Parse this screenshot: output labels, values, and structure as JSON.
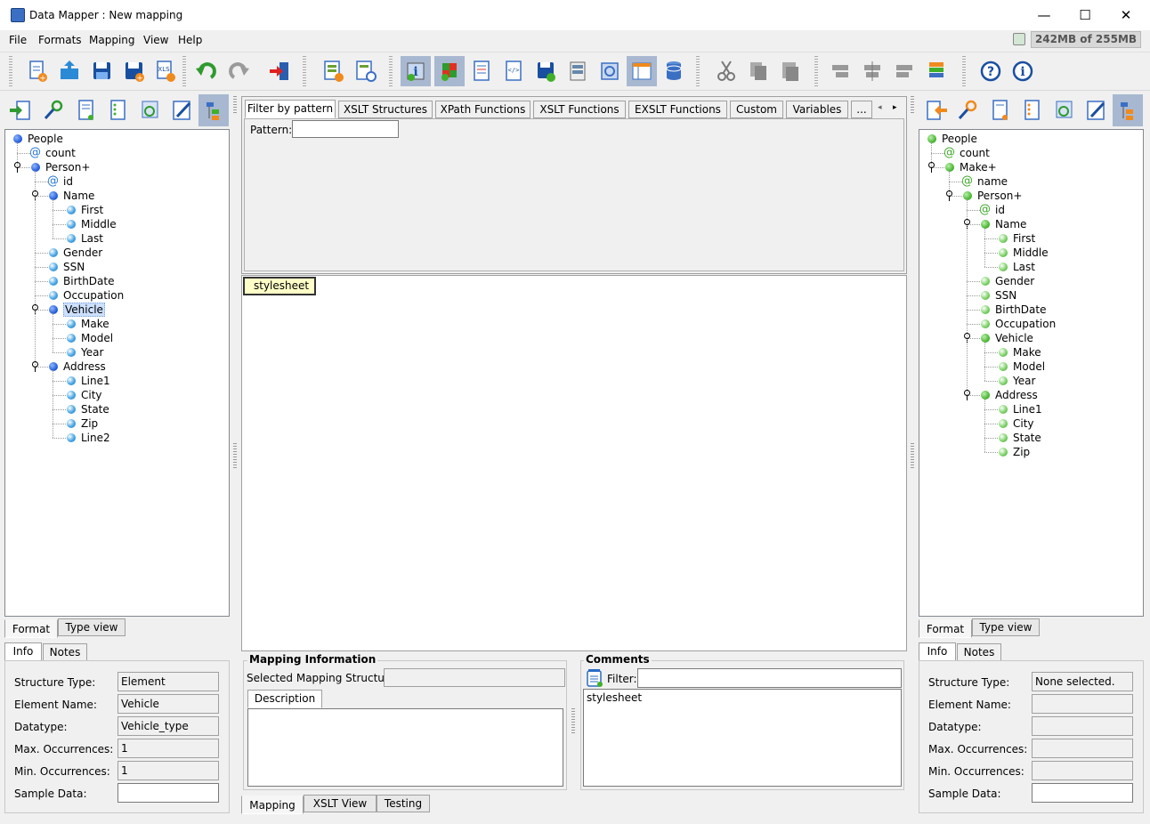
{
  "app": {
    "title": "Data Mapper : New mapping",
    "memory": "242MB of 255MB"
  },
  "window": {
    "minimize": "—",
    "maximize": "☐",
    "close": "✕"
  },
  "menu": [
    "File",
    "Formats",
    "Mapping",
    "View",
    "Help"
  ],
  "toolbar": {
    "icons": [
      "new-mapping-icon",
      "open-icon",
      "save-icon",
      "save-as-icon",
      "export-xls-icon",
      "undo-icon",
      "redo-icon",
      "exit-icon",
      "add-source-icon",
      "generate-icon",
      "info-icon",
      "color-map-icon",
      "properties-icon",
      "xml-view-icon",
      "save-disk-icon",
      "stack-icon",
      "config-icon",
      "table-icon",
      "database-icon",
      "cut-icon",
      "copy-icon",
      "paste-icon",
      "move-left-icon",
      "move-center-icon",
      "move-right-icon",
      "layers-icon",
      "help-icon",
      "about-icon"
    ]
  },
  "left": {
    "tree": [
      {
        "label": "People",
        "kind": "blue",
        "depth": 0
      },
      {
        "label": "count",
        "kind": "at",
        "depth": 1
      },
      {
        "label": "Person+",
        "kind": "blue",
        "depth": 1,
        "expanded": true
      },
      {
        "label": "id",
        "kind": "at",
        "depth": 2
      },
      {
        "label": "Name",
        "kind": "blue",
        "depth": 2,
        "expanded": true
      },
      {
        "label": "First",
        "kind": "leaf",
        "depth": 3
      },
      {
        "label": "Middle",
        "kind": "leaf",
        "depth": 3
      },
      {
        "label": "Last",
        "kind": "leaf",
        "depth": 3
      },
      {
        "label": "Gender",
        "kind": "leaf",
        "depth": 2
      },
      {
        "label": "SSN",
        "kind": "leaf",
        "depth": 2
      },
      {
        "label": "BirthDate",
        "kind": "leaf",
        "depth": 2
      },
      {
        "label": "Occupation",
        "kind": "leaf",
        "depth": 2
      },
      {
        "label": "Vehicle",
        "kind": "blue",
        "depth": 2,
        "expanded": true,
        "selected": true
      },
      {
        "label": "Make",
        "kind": "leaf",
        "depth": 3
      },
      {
        "label": "Model",
        "kind": "leaf",
        "depth": 3
      },
      {
        "label": "Year",
        "kind": "leaf",
        "depth": 3
      },
      {
        "label": "Address",
        "kind": "blue",
        "depth": 2,
        "expanded": true
      },
      {
        "label": "Line1",
        "kind": "leaf",
        "depth": 3
      },
      {
        "label": "City",
        "kind": "leaf",
        "depth": 3
      },
      {
        "label": "State",
        "kind": "leaf",
        "depth": 3
      },
      {
        "label": "Zip",
        "kind": "leaf",
        "depth": 3
      },
      {
        "label": "Line2",
        "kind": "leaf",
        "depth": 3
      }
    ],
    "tabs": [
      "Format",
      "Type view"
    ],
    "info_tabs": [
      "Info",
      "Notes"
    ],
    "info": {
      "labels": [
        "Structure Type:",
        "Element Name:",
        "Datatype:",
        "Max. Occurrences:",
        "Min. Occurrences:",
        "Sample Data:"
      ],
      "values": [
        "Element",
        "Vehicle",
        "Vehicle_type",
        "1",
        "1",
        ""
      ]
    }
  },
  "center": {
    "tabs": [
      "Filter by pattern",
      "XSLT Structures",
      "XPath Functions",
      "XSLT Functions",
      "EXSLT Functions",
      "Custom",
      "Variables",
      "..."
    ],
    "pattern_label": "Pattern:",
    "pattern_value": "",
    "stylesheet_node": "stylesheet",
    "mapping_info": {
      "title": "Mapping Information",
      "selected_label": "Selected Mapping Structure:",
      "selected_value": "",
      "description_tab": "Description"
    },
    "comments": {
      "title": "Comments",
      "filter_label": "Filter:",
      "filter_value": "",
      "items": [
        "stylesheet"
      ]
    },
    "bottom_tabs": [
      "Mapping",
      "XSLT View",
      "Testing"
    ]
  },
  "right": {
    "tree": [
      {
        "label": "People",
        "kind": "green",
        "depth": 0
      },
      {
        "label": "count",
        "kind": "at",
        "depth": 1
      },
      {
        "label": "Make+",
        "kind": "green",
        "depth": 1,
        "expanded": true
      },
      {
        "label": "name",
        "kind": "at",
        "depth": 2
      },
      {
        "label": "Person+",
        "kind": "green",
        "depth": 2,
        "expanded": true
      },
      {
        "label": "id",
        "kind": "at",
        "depth": 3
      },
      {
        "label": "Name",
        "kind": "green",
        "depth": 3,
        "expanded": true
      },
      {
        "label": "First",
        "kind": "leaf",
        "depth": 4
      },
      {
        "label": "Middle",
        "kind": "leaf",
        "depth": 4
      },
      {
        "label": "Last",
        "kind": "leaf",
        "depth": 4
      },
      {
        "label": "Gender",
        "kind": "leaf",
        "depth": 3
      },
      {
        "label": "SSN",
        "kind": "leaf",
        "depth": 3
      },
      {
        "label": "BirthDate",
        "kind": "leaf",
        "depth": 3
      },
      {
        "label": "Occupation",
        "kind": "leaf",
        "depth": 3
      },
      {
        "label": "Vehicle",
        "kind": "green",
        "depth": 3,
        "expanded": true
      },
      {
        "label": "Make",
        "kind": "leaf",
        "depth": 4
      },
      {
        "label": "Model",
        "kind": "leaf",
        "depth": 4
      },
      {
        "label": "Year",
        "kind": "leaf",
        "depth": 4
      },
      {
        "label": "Address",
        "kind": "green",
        "depth": 3,
        "expanded": true
      },
      {
        "label": "Line1",
        "kind": "leaf",
        "depth": 4
      },
      {
        "label": "City",
        "kind": "leaf",
        "depth": 4
      },
      {
        "label": "State",
        "kind": "leaf",
        "depth": 4
      },
      {
        "label": "Zip",
        "kind": "leaf",
        "depth": 4
      }
    ],
    "tabs": [
      "Format",
      "Type view"
    ],
    "info_tabs": [
      "Info",
      "Notes"
    ],
    "info": {
      "labels": [
        "Structure Type:",
        "Element Name:",
        "Datatype:",
        "Max. Occurrences:",
        "Min. Occurrences:",
        "Sample Data:"
      ],
      "values": [
        "None selected.",
        "",
        "",
        "",
        "",
        ""
      ]
    }
  }
}
